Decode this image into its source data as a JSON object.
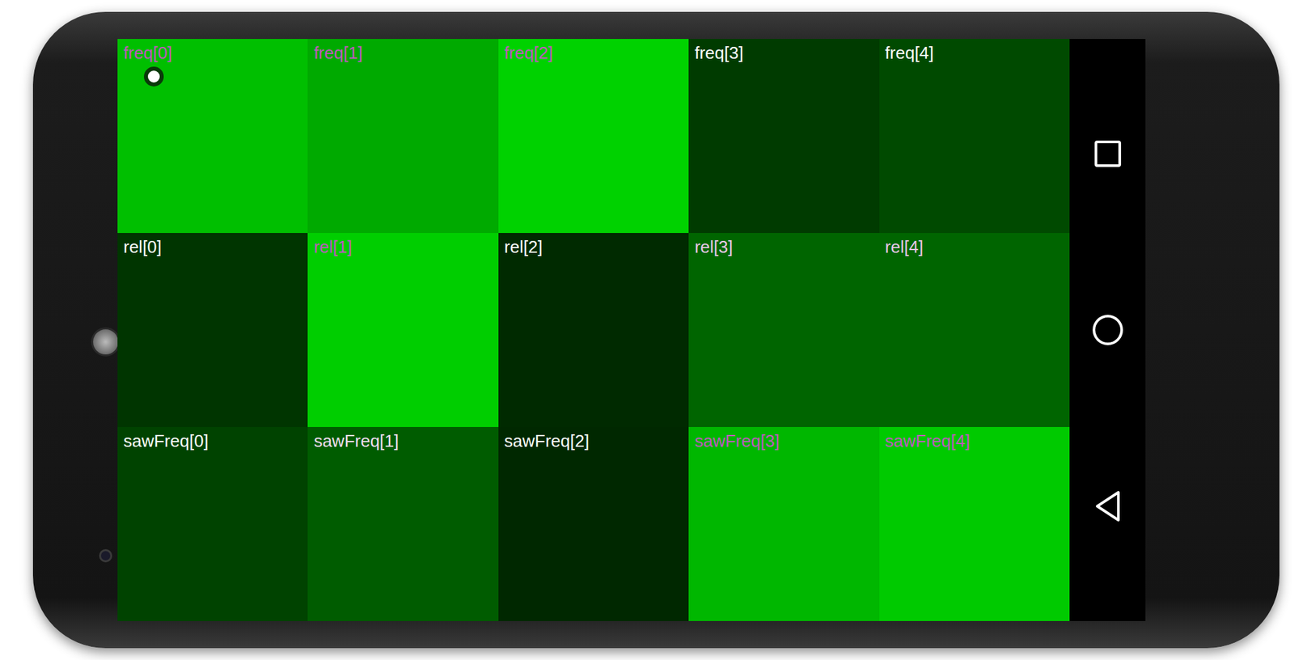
{
  "grid": {
    "rows": [
      {
        "cells": [
          {
            "label": "freq[0]",
            "level": 0.91,
            "touched": true
          },
          {
            "label": "freq[1]",
            "level": 0.81,
            "touched": false
          },
          {
            "label": "freq[2]",
            "level": 1.0,
            "touched": false
          },
          {
            "label": "freq[3]",
            "level": 0.28,
            "touched": false
          },
          {
            "label": "freq[4]",
            "level": 0.35,
            "touched": false
          }
        ]
      },
      {
        "cells": [
          {
            "label": "rel[0]",
            "level": 0.25,
            "touched": false
          },
          {
            "label": "rel[1]",
            "level": 0.98,
            "touched": false
          },
          {
            "label": "rel[2]",
            "level": 0.2,
            "touched": false
          },
          {
            "label": "rel[3]",
            "level": 0.48,
            "touched": false
          },
          {
            "label": "rel[4]",
            "level": 0.48,
            "touched": false
          }
        ]
      },
      {
        "cells": [
          {
            "label": "sawFreq[0]",
            "level": 0.32,
            "touched": false
          },
          {
            "label": "sawFreq[1]",
            "level": 0.44,
            "touched": false
          },
          {
            "label": "sawFreq[2]",
            "level": 0.19,
            "touched": false
          },
          {
            "label": "sawFreq[3]",
            "level": 0.87,
            "touched": false
          },
          {
            "label": "sawFreq[4]",
            "level": 0.96,
            "touched": false
          }
        ]
      }
    ]
  },
  "nav_bar": {
    "buttons": [
      {
        "kind": "recents"
      },
      {
        "kind": "home"
      },
      {
        "kind": "back"
      }
    ]
  }
}
